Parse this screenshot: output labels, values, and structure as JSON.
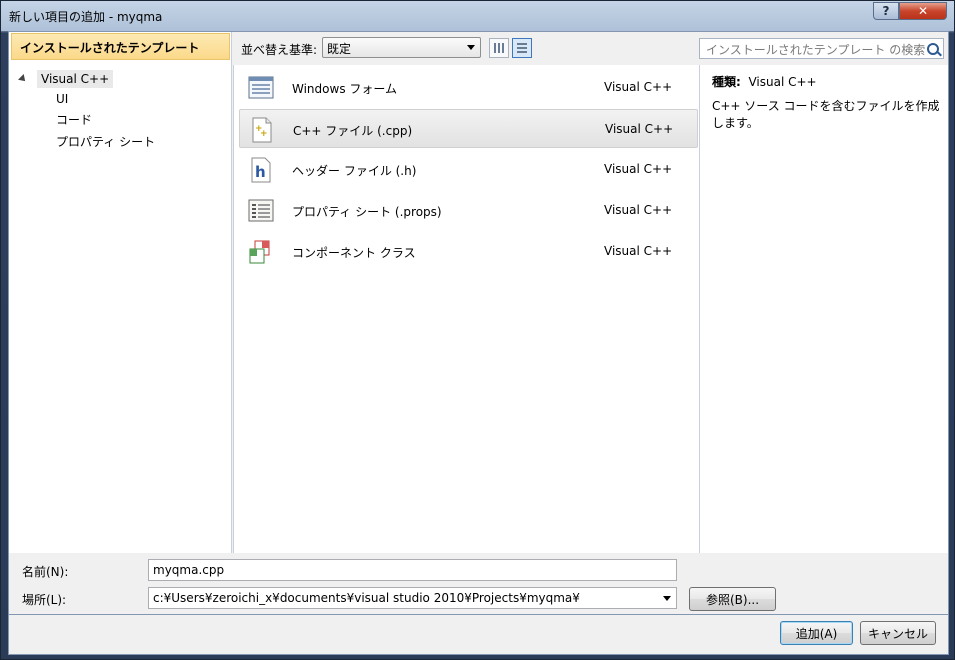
{
  "window": {
    "title": "新しい項目の追加 - myqma",
    "help_label": "?",
    "close_label": "✕"
  },
  "left_panel": {
    "header": "インストールされたテンプレート",
    "tree_root": "Visual C++",
    "tree_children": [
      "UI",
      "コード",
      "プロパティ シート"
    ]
  },
  "toolbar": {
    "sort_label": "並べ替え基準:",
    "sort_value": "既定",
    "search_placeholder": "インストールされたテンプレート の検索"
  },
  "templates": [
    {
      "name": "Windows フォーム",
      "lang": "Visual C++",
      "icon": "windows-form-icon",
      "selected": false
    },
    {
      "name": "C++ ファイル (.cpp)",
      "lang": "Visual C++",
      "icon": "cpp-file-icon",
      "selected": true
    },
    {
      "name": "ヘッダー ファイル (.h)",
      "lang": "Visual C++",
      "icon": "header-file-icon",
      "selected": false
    },
    {
      "name": "プロパティ シート (.props)",
      "lang": "Visual C++",
      "icon": "property-sheet-icon",
      "selected": false
    },
    {
      "name": "コンポーネント クラス",
      "lang": "Visual C++",
      "icon": "component-class-icon",
      "selected": false
    }
  ],
  "description": {
    "type_label": "種類:",
    "type_value": "Visual C++",
    "text": "C++ ソース コードを含むファイルを作成します。"
  },
  "form": {
    "name_label": "名前(N):",
    "name_value": "myqma.cpp",
    "location_label": "場所(L):",
    "location_value": "c:¥Users¥zeroichi_x¥documents¥visual studio 2010¥Projects¥myqma¥",
    "browse_label": "参照(B)..."
  },
  "buttons": {
    "add_label": "追加(A)",
    "cancel_label": "キャンセル"
  }
}
